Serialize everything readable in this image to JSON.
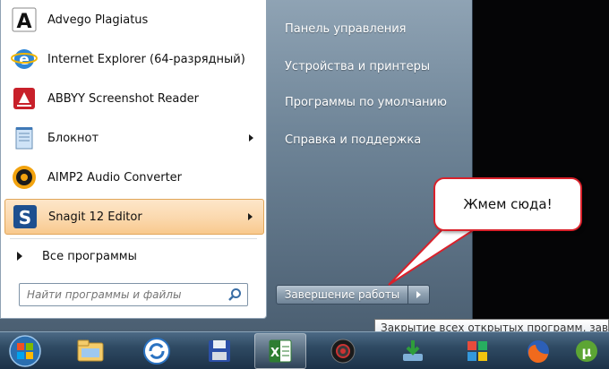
{
  "start_menu": {
    "programs": [
      {
        "label": "Advego Plagiatus",
        "icon": "advego-icon",
        "has_submenu": false
      },
      {
        "label": "Internet Explorer (64-разрядный)",
        "icon": "internet-explorer-icon",
        "has_submenu": false
      },
      {
        "label": "ABBYY Screenshot Reader",
        "icon": "abbyy-icon",
        "has_submenu": false
      },
      {
        "label": "Блокнот",
        "icon": "notepad-icon",
        "has_submenu": true
      },
      {
        "label": "AIMP2 Audio Converter",
        "icon": "aimp-icon",
        "has_submenu": false
      },
      {
        "label": "Snagit 12 Editor",
        "icon": "snagit-icon",
        "has_submenu": true,
        "highlighted": true
      }
    ],
    "all_programs_label": "Все программы",
    "search": {
      "placeholder": "Найти программы и файлы",
      "value": ""
    },
    "right_links": [
      "Панель управления",
      "Устройства и принтеры",
      "Программы по умолчанию",
      "Справка и поддержка"
    ],
    "shutdown_label": "Завершение работы"
  },
  "callout_text": "Жмем сюда!",
  "tooltip_text": "Закрытие всех открытых программ, заве",
  "taskbar": {
    "buttons": [
      "start-orb-icon",
      "file-explorer-icon",
      "sync-icon",
      "save-floppy-icon",
      "excel-icon",
      "camera-icon",
      "download-icon",
      "tiles-app-icon",
      "firefox-icon",
      "utorrent-icon"
    ]
  },
  "colors": {
    "highlight": "#fbd8ad",
    "callout_border": "#d9212b",
    "taskbar": "#2f4a63"
  }
}
